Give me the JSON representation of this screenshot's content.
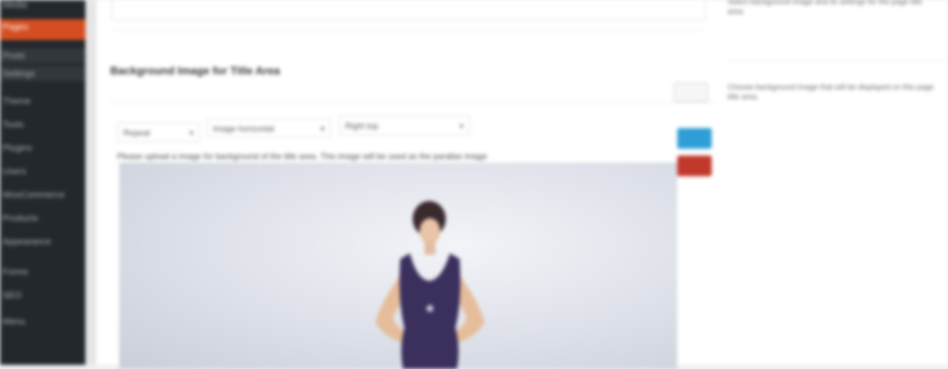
{
  "sidebar": {
    "items": [
      {
        "label": "Media"
      },
      {
        "label": "Pages"
      },
      {
        "label": "Posts"
      },
      {
        "label": "Settings"
      },
      {
        "label": "Theme"
      },
      {
        "label": "Tools"
      },
      {
        "label": "Plugins"
      },
      {
        "label": "Users"
      },
      {
        "label": "WooCommerce"
      },
      {
        "label": "Products"
      },
      {
        "label": "Appearance"
      },
      {
        "label": "Forms"
      },
      {
        "label": "SEO"
      },
      {
        "label": "Menu"
      }
    ]
  },
  "main": {
    "section_title": "Background Image for Title Area",
    "fields": {
      "repeat": "Repeat",
      "position": "Image horizontal",
      "size": "Right top"
    },
    "hint": "Please upload a image for background of the title area. This image will be used as the parallax image"
  },
  "right": {
    "description_1": "Select background image and its settings for the page title area.",
    "description_2": "Choose background image that will be displayed on this page title area."
  },
  "colors": {
    "sidebar_bg": "#23282d",
    "active_menu": "#d54e21",
    "primary_button": "#2e9fd6",
    "remove_button": "#c0392b"
  }
}
